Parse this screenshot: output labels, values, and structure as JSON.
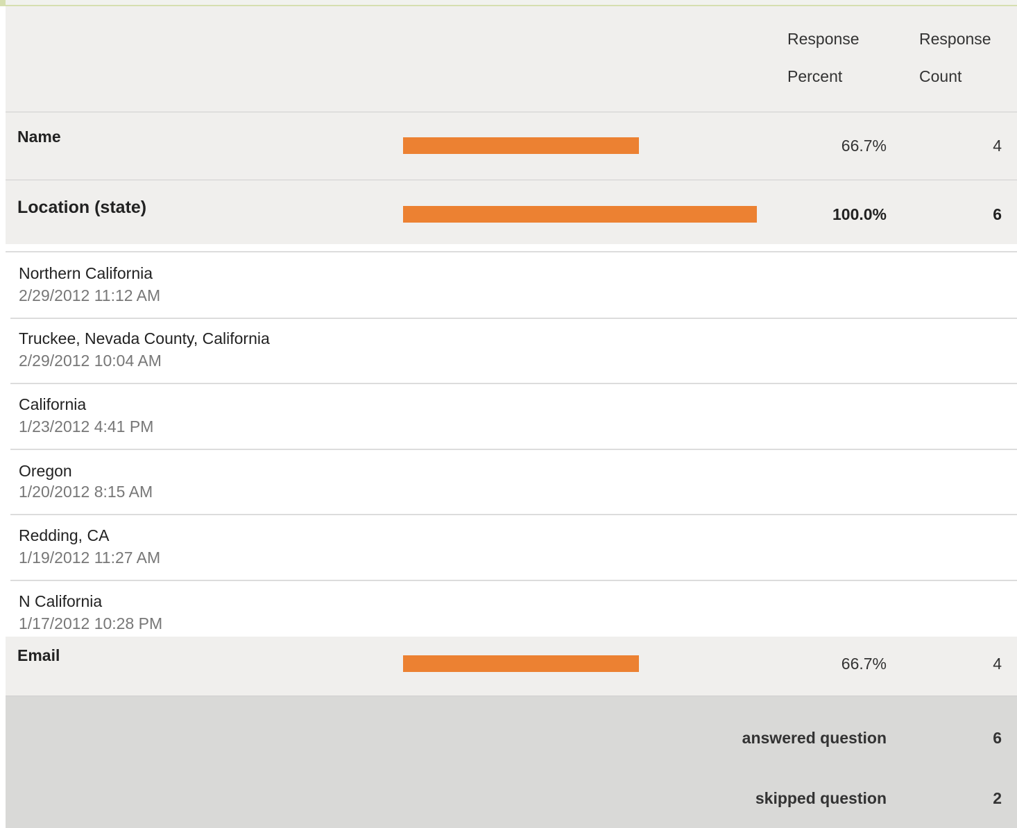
{
  "header": {
    "percent_label_1": "Response",
    "percent_label_2": "Percent",
    "count_label_1": "Response",
    "count_label_2": "Count"
  },
  "questions": [
    {
      "label": "Name",
      "percent_text": "66.7%",
      "fraction": 0.667,
      "count": "4"
    },
    {
      "label": "Location (state)",
      "percent_text": "100.0%",
      "fraction": 1.0,
      "count": "6"
    },
    {
      "label": "Email",
      "percent_text": "66.7%",
      "fraction": 0.667,
      "count": "4"
    }
  ],
  "location_responses": [
    {
      "text": "Northern California",
      "date": "2/29/2012 11:12 AM"
    },
    {
      "text": "Truckee, Nevada County, California",
      "date": "2/29/2012 10:04 AM"
    },
    {
      "text": "California",
      "date": "1/23/2012 4:41 PM"
    },
    {
      "text": "Oregon",
      "date": "1/20/2012 8:15 AM"
    },
    {
      "text": "Redding, CA",
      "date": "1/19/2012 11:27 AM"
    },
    {
      "text": "N California",
      "date": "1/17/2012 10:28 PM"
    }
  ],
  "footer": {
    "answered_label": "answered question",
    "answered_value": "6",
    "skipped_label": "skipped question",
    "skipped_value": "2"
  },
  "colors": {
    "bar": "#ec8132",
    "row_background": "#f0efed",
    "footer_background": "#d9d9d7",
    "top_strip": "#d6dfb0"
  }
}
